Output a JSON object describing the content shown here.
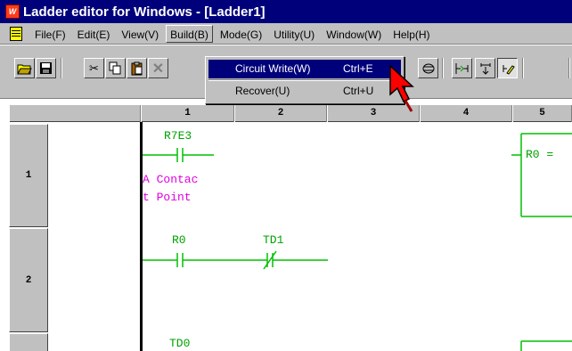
{
  "window": {
    "title": "Ladder editor for Windows - [Ladder1]",
    "icon": "app-logo-icon"
  },
  "menu": [
    {
      "label": "File(F)"
    },
    {
      "label": "Edit(E)"
    },
    {
      "label": "View(V)"
    },
    {
      "label": "Build(B)"
    },
    {
      "label": "Mode(G)"
    },
    {
      "label": "Utility(U)"
    },
    {
      "label": "Window(W)"
    },
    {
      "label": "Help(H)"
    }
  ],
  "build_menu": {
    "items": [
      {
        "label": "Circuit Write(W)",
        "shortcut": "Ctrl+E"
      },
      {
        "label": "Recover(U)",
        "shortcut": "Ctrl+U"
      }
    ]
  },
  "ruler": {
    "columns": [
      "1",
      "2",
      "3",
      "4",
      "5"
    ]
  },
  "rows": {
    "headers": [
      "1",
      "2"
    ]
  },
  "ladder": {
    "row1": {
      "contact_label": "R7E3",
      "comment_line1": "A Contac",
      "comment_line2": "t Point",
      "output": "R0 ="
    },
    "row2": {
      "contact1_label": "R0",
      "contact2_label": "TD1"
    },
    "row3": {
      "contact_label": "TD0"
    }
  },
  "colors": {
    "title_bar": "#00007b",
    "ladder_element": "#00c000",
    "comment": "#e000e0",
    "highlight": "#00007b",
    "cursor_arrow": "#ff0000"
  }
}
